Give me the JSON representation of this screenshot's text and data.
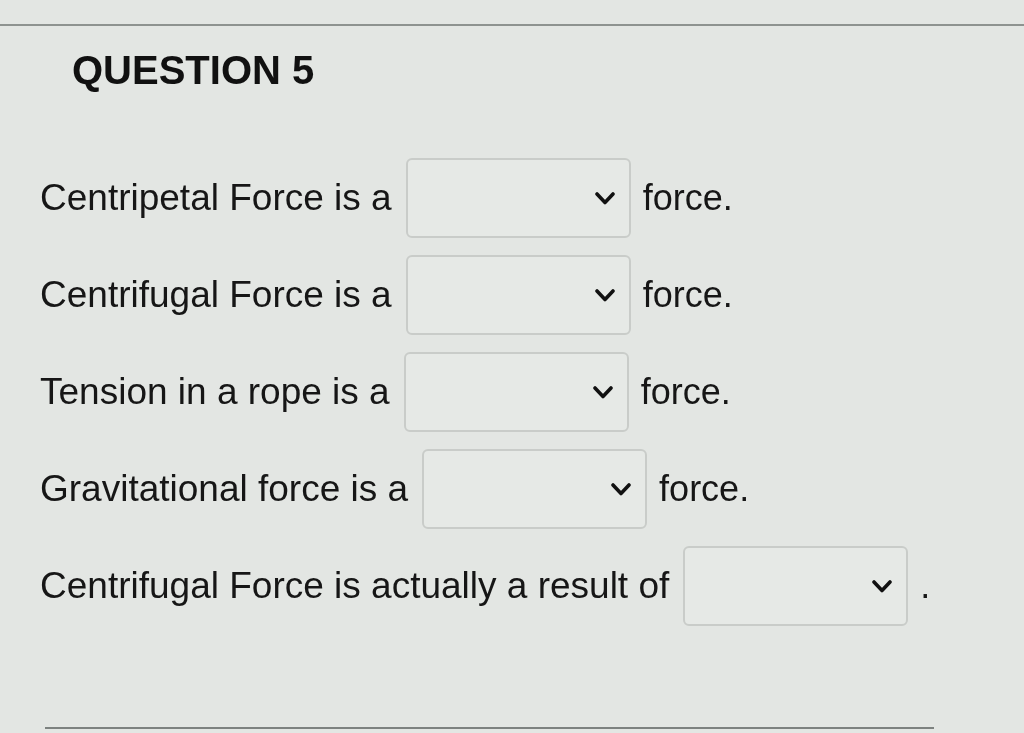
{
  "question": {
    "title": "QUESTION 5",
    "items": [
      {
        "prefix": "Centripetal Force is a",
        "suffix": "force."
      },
      {
        "prefix": "Centrifugal Force is a",
        "suffix": "force."
      },
      {
        "prefix": "Tension in a rope is a",
        "suffix": "force."
      },
      {
        "prefix": "Gravitational force is a",
        "suffix": "force."
      },
      {
        "prefix": "Centrifugal Force is actually a result of",
        "suffix": "."
      }
    ]
  }
}
